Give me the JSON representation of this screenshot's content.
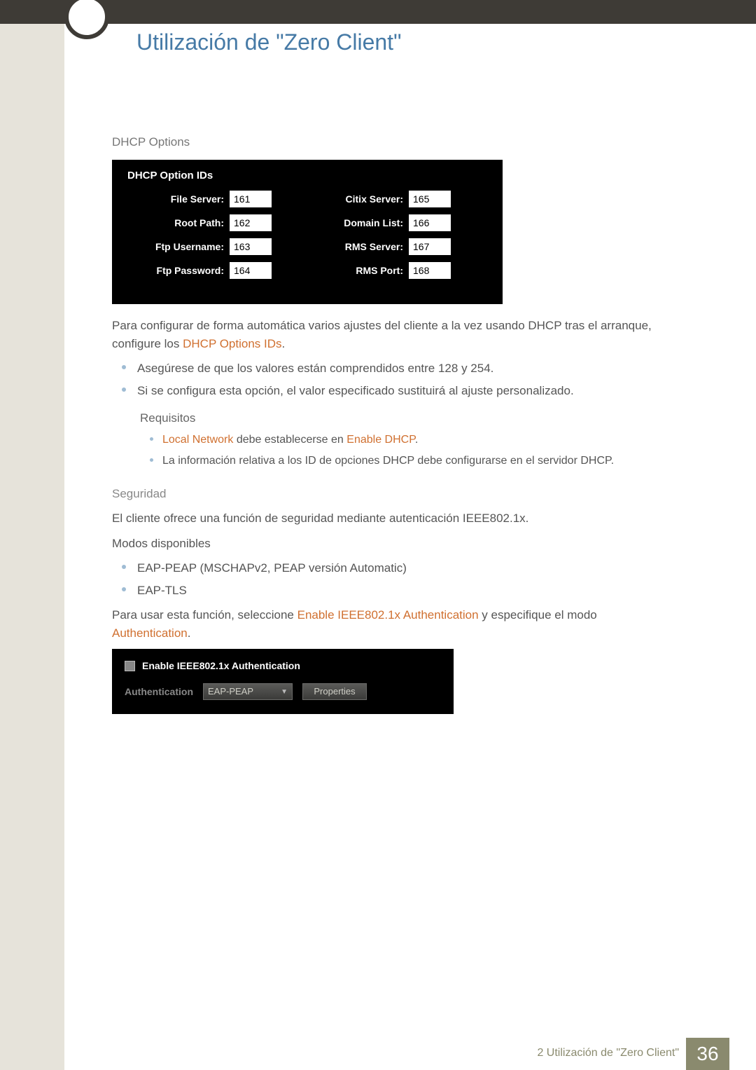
{
  "header": {
    "title": "Utilización de \"Zero Client\""
  },
  "dhcp": {
    "section_label": "DHCP Options",
    "panel_title": "DHCP Option IDs",
    "rows": [
      {
        "l_label": "File Server:",
        "l_val": "161",
        "r_label": "Citix Server:",
        "r_val": "165"
      },
      {
        "l_label": "Root Path:",
        "l_val": "162",
        "r_label": "Domain List:",
        "r_val": "166"
      },
      {
        "l_label": "Ftp Username:",
        "l_val": "163",
        "r_label": "RMS Server:",
        "r_val": "167"
      },
      {
        "l_label": "Ftp Password:",
        "l_val": "164",
        "r_label": "RMS Port:",
        "r_val": "168"
      }
    ],
    "para1_a": "Para configurar de forma automática varios ajustes del cliente a la vez usando DHCP tras el arranque, configure los ",
    "para1_hl": "DHCP Options IDs",
    "para1_c": ".",
    "bullets": [
      "Asegúrese de que los valores están comprendidos entre 128 y 254.",
      "Si se configura esta opción, el valor especificado sustituirá al ajuste personalizado."
    ],
    "req_title": "Requisitos",
    "req_items": {
      "i1_a": "Local Network",
      "i1_b": " debe establecerse en ",
      "i1_c": "Enable DHCP",
      "i1_d": ".",
      "i2": "La información relativa a los ID de opciones DHCP debe configurarse en el servidor DHCP."
    }
  },
  "security": {
    "heading": "Seguridad",
    "intro": "El cliente ofrece una función de seguridad mediante autenticación IEEE802.1x.",
    "modes_label": "Modos disponibles",
    "modes": [
      "EAP-PEAP (MSCHAPv2, PEAP versión Automatic)",
      "EAP-TLS"
    ],
    "use_a": "Para usar esta función, seleccione ",
    "use_hl1": "Enable IEEE802.1x Authentication",
    "use_b": " y especifique el modo ",
    "use_hl2": "Authentication",
    "use_c": ".",
    "panel": {
      "checkbox_label": "Enable IEEE802.1x Authentication",
      "auth_label": "Authentication",
      "select_value": "EAP-PEAP",
      "button_label": "Properties"
    }
  },
  "footer": {
    "text": "2 Utilización de \"Zero Client\"",
    "page": "36"
  }
}
